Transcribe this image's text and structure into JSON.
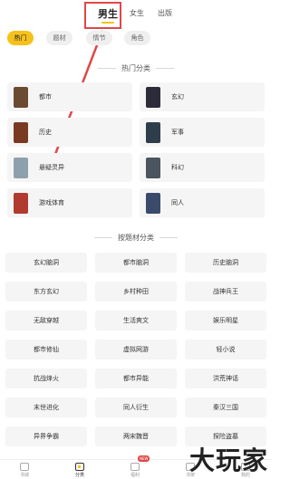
{
  "top_tabs": [
    {
      "label": "男生",
      "active": true
    },
    {
      "label": "女生",
      "active": false
    },
    {
      "label": "出版",
      "active": false
    }
  ],
  "chips": [
    {
      "label": "热门",
      "active": true
    },
    {
      "label": "题材",
      "active": false
    },
    {
      "label": "情节",
      "active": false
    },
    {
      "label": "角色",
      "active": false
    }
  ],
  "hot_section": {
    "title": "热门分类",
    "categories": [
      {
        "label": "都市",
        "cover_color": "#6b4a2f"
      },
      {
        "label": "玄幻",
        "cover_color": "#2b2b3a"
      },
      {
        "label": "历史",
        "cover_color": "#7a3a22"
      },
      {
        "label": "军事",
        "cover_color": "#2e3d4a"
      },
      {
        "label": "悬疑灵异",
        "cover_color": "#8fa0ad"
      },
      {
        "label": "科幻",
        "cover_color": "#4a5560"
      },
      {
        "label": "游戏体育",
        "cover_color": "#b03a2e"
      },
      {
        "label": "同人",
        "cover_color": "#3a4a6b"
      }
    ]
  },
  "theme_section": {
    "title": "按题材分类",
    "items": [
      "玄幻脑洞",
      "都市脑洞",
      "历史脑洞",
      "东方玄幻",
      "乡村种田",
      "战神兵王",
      "无敌穿越",
      "生活爽文",
      "娱乐明星",
      "都市修仙",
      "虚拟网游",
      "轻小说",
      "抗战烽火",
      "都市异能",
      "洪荒神话",
      "末世进化",
      "同人衍生",
      "秦汉三国",
      "异界争霸",
      "两宋魏晋",
      "探险盗墓"
    ]
  },
  "bottom_nav": [
    {
      "label": "书城",
      "icon": "bookstore-icon",
      "active": false
    },
    {
      "label": "分类",
      "icon": "category-icon",
      "active": true
    },
    {
      "label": "福利",
      "icon": "gift-icon",
      "active": false,
      "badge": "NEW"
    },
    {
      "label": "书架",
      "icon": "bookshelf-icon",
      "active": false
    },
    {
      "label": "我的",
      "icon": "profile-icon",
      "active": false
    }
  ],
  "watermark": "大玩家",
  "colors": {
    "accent": "#f6c11b",
    "annotation": "#e04848"
  }
}
